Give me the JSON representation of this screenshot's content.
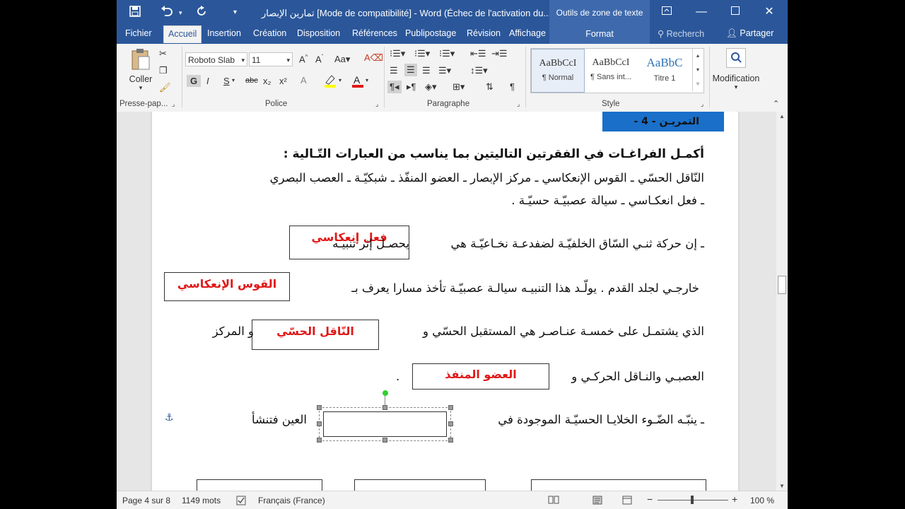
{
  "window": {
    "title": "تمارين الإبصار [Mode de compatibilité] - Word (Échec de l'activation du...",
    "context_tools": "Outils de zone de texte",
    "colors": {
      "titlebar": "#2b579a",
      "context": "#3e6aad",
      "answer_red": "#e01818"
    }
  },
  "quick_access": {
    "save_icon": "save-icon",
    "undo_icon": "undo-icon",
    "redo_icon": "redo-icon"
  },
  "tabs": {
    "items": [
      "Fichier",
      "Accueil",
      "Insertion",
      "Création",
      "Disposition",
      "Références",
      "Publipostage",
      "Révision",
      "Affichage",
      "Format"
    ],
    "active": "Accueil",
    "search": "Recherch",
    "share": "Partager"
  },
  "ribbon": {
    "clipboard": {
      "paste": "Coller",
      "label": "Presse-pap..."
    },
    "font": {
      "name": "Roboto Slab",
      "size": "11",
      "label": "Police",
      "format_buttons": [
        "G",
        "I",
        "S",
        "abc",
        "x₂",
        "x²"
      ]
    },
    "paragraph": {
      "label": "Paragraphe"
    },
    "styles": {
      "label": "Style",
      "items": [
        {
          "preview": "AaBbCcI",
          "name": "¶ Normal"
        },
        {
          "preview": "AaBbCcI",
          "name": "¶ Sans int..."
        },
        {
          "preview": "AaBbC",
          "name": "Titre 1"
        }
      ]
    },
    "editing": {
      "label": "Modification"
    }
  },
  "document": {
    "exercise_title": "التمريـن - 4 -",
    "instruction": "أكمـل الفراغـات في الفقرتين التاليتين بما يناسب من العبارات التّـالية :",
    "terms_line1": "النّاقل الحسّي ـ القوس الإنعكاسي ـ مركز الإبصار ـ العضو المنفّذ ـ شبكيّـة ـ العصب البصري",
    "terms_line2": "ـ فعل انعكـاسي ـ سيالة عصبيّـة حسيّـة .",
    "p1_a": "ـ إن حركة ثنـي السّاق الخلفيّـة لضفدعـة نخـاعيّـة هي",
    "p1_b": "يحصـل إثر تنبيـه",
    "p2_a": "خارجـي لجلد القدم . يولّـد هذا التنبيـه سيالـة عصبيّـة تأخذ مسارا يعرف بـ",
    "p3_a": "الذي يشتمـل على خمسـة عنـاصـر هي المستقبل الحسّي و",
    "p3_b": "و المركز",
    "p4_a": "العصبـي والنـاقل الحركـي و",
    "p4_b": ".",
    "p5_a": "ـ ينبّـه الضّـوء الخلايـا الحسيّـة الموجودة في",
    "p5_b": "العين فتنشأ",
    "answers": [
      "فعل إنعكاسي",
      "القوس الإنعكاسي",
      "النّاقل الحسّي",
      "العضو المنفذ"
    ]
  },
  "status": {
    "page": "Page 4 sur 8",
    "words": "1149 mots",
    "language": "Français (France)",
    "zoom": "100 %"
  }
}
